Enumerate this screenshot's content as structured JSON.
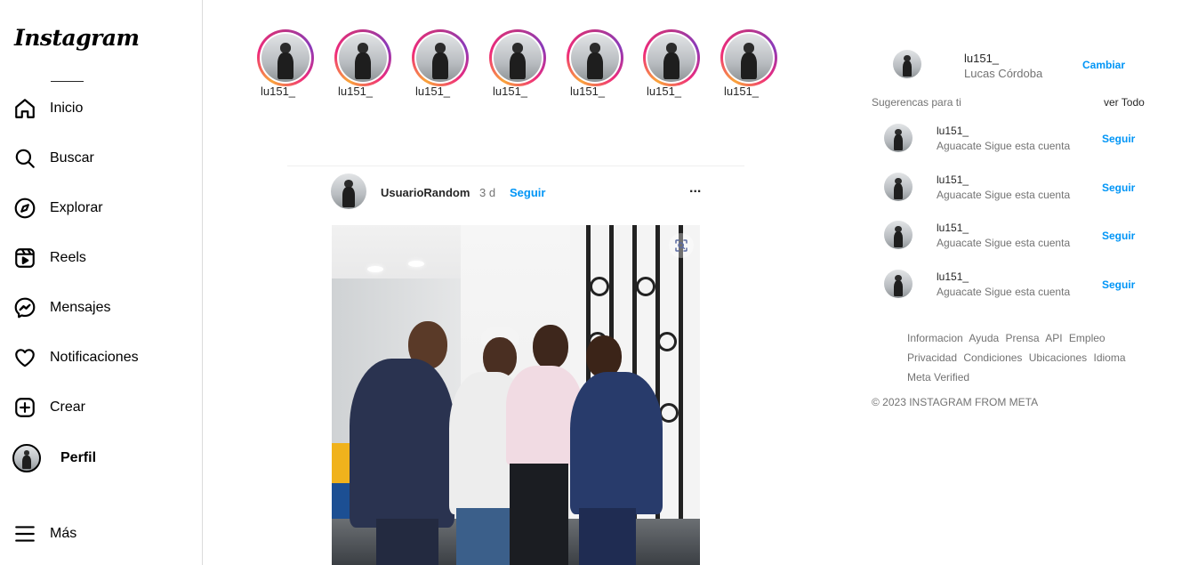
{
  "app": {
    "logo": "Instagram"
  },
  "sidebar": {
    "items": [
      {
        "label": "Inicio",
        "icon": "home-icon"
      },
      {
        "label": "Buscar",
        "icon": "search-icon"
      },
      {
        "label": "Explorar",
        "icon": "compass-icon"
      },
      {
        "label": "Reels",
        "icon": "reels-icon"
      },
      {
        "label": "Mensajes",
        "icon": "messenger-icon"
      },
      {
        "label": "Notificaciones",
        "icon": "heart-icon"
      },
      {
        "label": "Crear",
        "icon": "plus-square-icon"
      },
      {
        "label": "Perfil",
        "icon": "avatar"
      },
      {
        "label": "Más",
        "icon": "menu-icon"
      }
    ]
  },
  "stories": [
    {
      "name": "lu151_"
    },
    {
      "name": "lu151_"
    },
    {
      "name": "lu151_"
    },
    {
      "name": "lu151_"
    },
    {
      "name": "lu151_"
    },
    {
      "name": "lu151_"
    },
    {
      "name": "lu151_"
    }
  ],
  "post": {
    "username": "UsuarioRandom",
    "time": "3 d",
    "follow_label": "Seguir",
    "more_label": "..."
  },
  "profile": {
    "username": "lu151_",
    "full_name": "Lucas Córdoba",
    "switch_label": "Cambiar"
  },
  "suggestions": {
    "title": "Sugerencas para ti",
    "see_all": "ver Todo",
    "items": [
      {
        "username": "lu151_",
        "subtitle": "Aguacate Sigue esta cuenta",
        "action": "Seguir"
      },
      {
        "username": "lu151_",
        "subtitle": "Aguacate Sigue esta cuenta",
        "action": "Seguir"
      },
      {
        "username": "lu151_",
        "subtitle": "Aguacate Sigue esta cuenta",
        "action": "Seguir"
      },
      {
        "username": "lu151_",
        "subtitle": "Aguacate Sigue esta cuenta",
        "action": "Seguir"
      }
    ]
  },
  "footer": {
    "links": [
      "Informacion",
      "Ayuda",
      "Prensa",
      "API",
      "Empleo",
      "Privacidad",
      "Condiciones",
      "Ubicaciones",
      "Idioma",
      "Meta Verified"
    ],
    "copyright": "© 2023 INSTAGRAM FROM META"
  },
  "colors": {
    "link": "#0095f6",
    "muted": "#737373",
    "text": "#262626",
    "border": "#dbdbdb"
  }
}
